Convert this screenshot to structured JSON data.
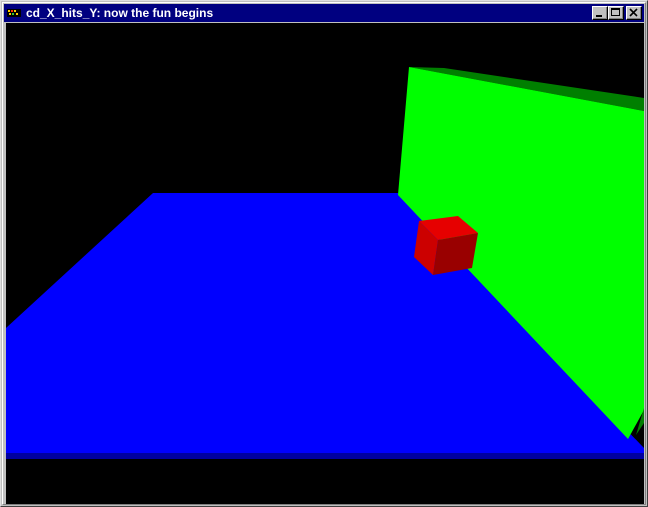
{
  "window": {
    "title": "cd_X_hits_Y: now the fun begins",
    "icon": "opengl-app-icon",
    "buttons": {
      "minimize": "minimize-icon",
      "maximize": "maximize-icon",
      "close": "close-icon"
    }
  },
  "scene": {
    "background_color": "#000000",
    "floor_color": "#0000ff",
    "floor_edge_color": "#0000a0",
    "wall_color": "#00ff00",
    "wall_top_color": "#008000",
    "cube_front_color": "#cc0000",
    "cube_top_color": "#e00000",
    "cube_side_color": "#990000"
  }
}
